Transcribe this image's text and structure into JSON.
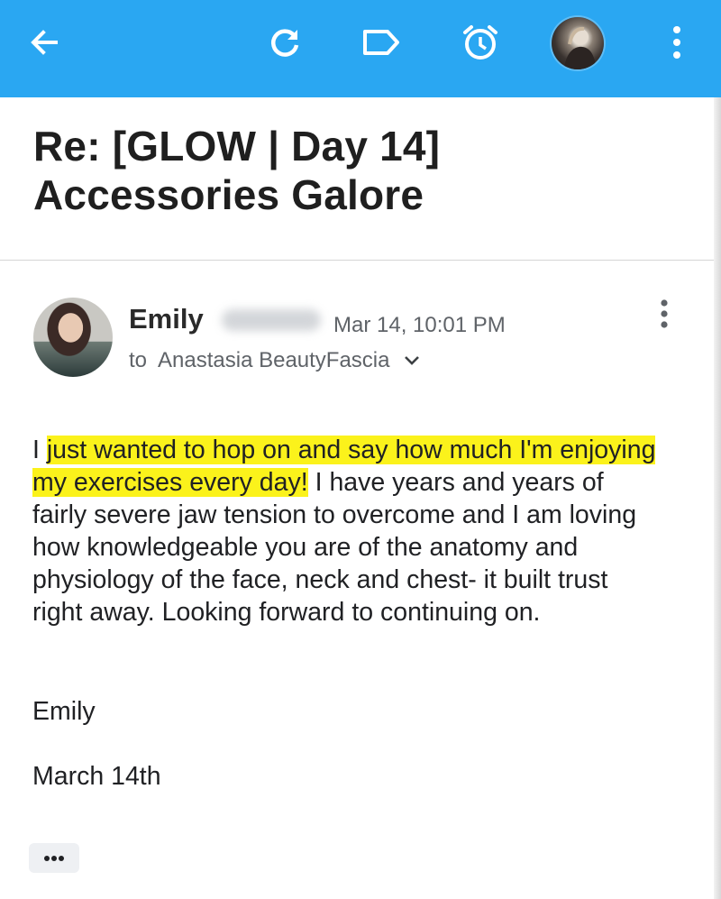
{
  "toolbar": {
    "back_icon": "back-arrow-icon",
    "refresh_icon": "refresh-icon",
    "label_icon": "label-icon",
    "snooze_icon": "snooze-clock-icon",
    "more_icon": "more-vert-icon",
    "background_color": "#2aa7f2"
  },
  "subject": {
    "line1": "Re: [GLOW | Day 14]",
    "line2": "Accessories Galore"
  },
  "message": {
    "sender_name": "Emily",
    "date": "Mar 14, 10:01 PM",
    "to_prefix": "to",
    "recipient": "Anastasia BeautyFascia",
    "body": {
      "p1_start": "I ",
      "p1_highlight": "just wanted to hop on and say how much I'm enjoying my exercises every day!",
      "p1_rest": " I have years and years of fairly severe jaw tension to overcome and I am loving how knowledgeable you are of the anatomy and physiology of the face, neck and chest- it built trust right away. Looking forward to continuing on.",
      "highlight_color": "#fbf21b"
    },
    "signature_name": "Emily",
    "signature_date": "March 14th",
    "trimmed_content_icon": "more-horiz-icon"
  }
}
